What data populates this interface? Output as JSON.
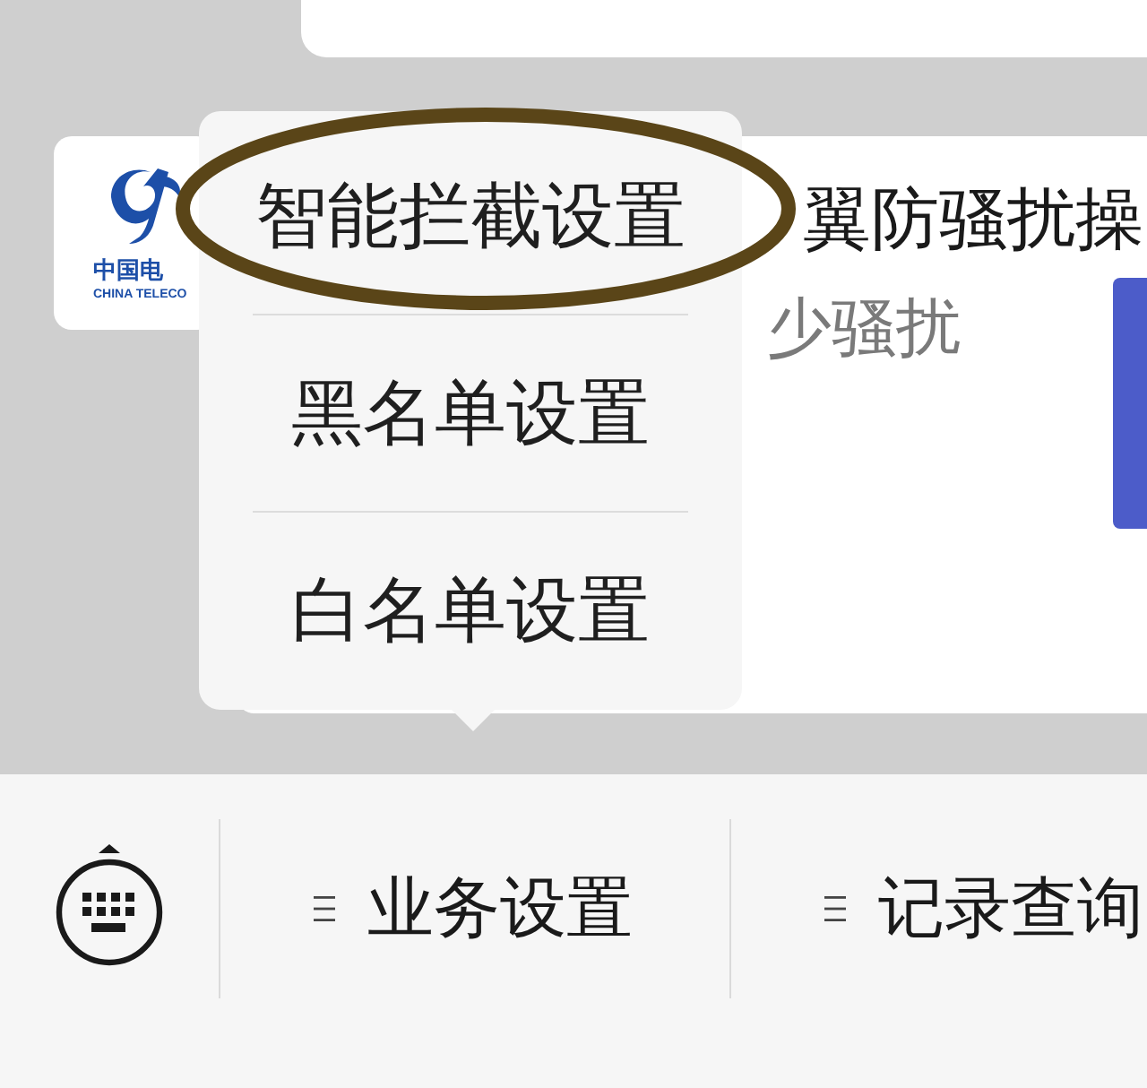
{
  "message": {
    "logo": {
      "name": "中国电",
      "name_latin": "CHINA TELECO"
    },
    "title": "翼防骚扰操",
    "subtitle": "少骚扰"
  },
  "popup_menu": {
    "items": [
      {
        "label": "智能拦截设置",
        "circled": true
      },
      {
        "label": "黑名单设置",
        "circled": false
      },
      {
        "label": "白名单设置",
        "circled": false
      }
    ]
  },
  "bottom_bar": {
    "menus": [
      {
        "label": "业务设置"
      },
      {
        "label": "记录查询"
      }
    ]
  }
}
